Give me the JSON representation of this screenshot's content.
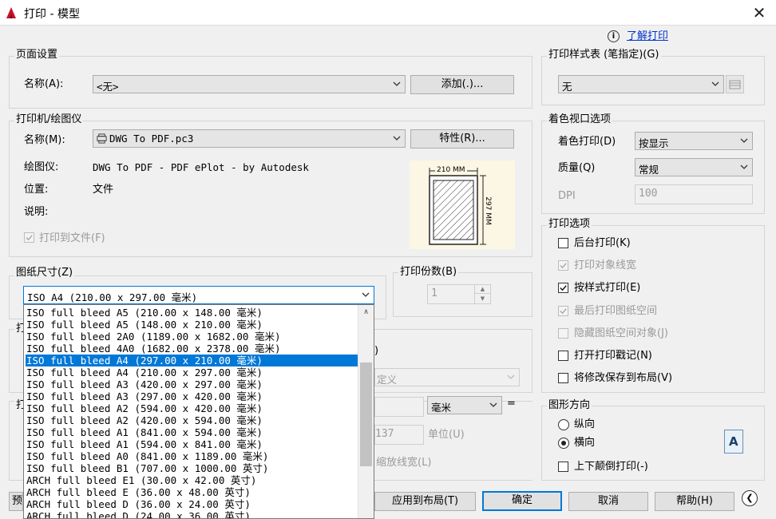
{
  "window": {
    "title": "打印 - 模型"
  },
  "help_link": "了解打印",
  "page_setup": {
    "group_label": "页面设置",
    "name_label": "名称(A):",
    "name_value": "<无>",
    "add_button": "添加(.)..."
  },
  "printer": {
    "group_label": "打印机/绘图仪",
    "name_label": "名称(M):",
    "name_value": "DWG To PDF.pc3",
    "properties_button": "特性(R)...",
    "plotter_label": "绘图仪:",
    "plotter_value": "DWG To PDF - PDF ePlot - by Autodesk",
    "location_label": "位置:",
    "location_value": "文件",
    "description_label": "说明:",
    "print_to_file_label": "打印到文件(F)",
    "preview_width": "210 MM",
    "preview_height": "297 MM"
  },
  "paper_size": {
    "group_label": "图纸尺寸(Z)",
    "selected": "ISO A4 (210.00 x 297.00 毫米)",
    "options": [
      "ISO full bleed A5 (210.00 x 148.00 毫米)",
      "ISO full bleed A5 (148.00 x 210.00 毫米)",
      "ISO full bleed 2A0 (1189.00 x 1682.00 毫米)",
      "ISO full bleed 4A0 (1682.00 x 2378.00 毫米)",
      "ISO full bleed A4 (297.00 x 210.00 毫米)",
      "ISO full bleed A4 (210.00 x 297.00 毫米)",
      "ISO full bleed A3 (420.00 x 297.00 毫米)",
      "ISO full bleed A3 (297.00 x 420.00 毫米)",
      "ISO full bleed A2 (594.00 x 420.00 毫米)",
      "ISO full bleed A2 (420.00 x 594.00 毫米)",
      "ISO full bleed A1 (841.00 x 594.00 毫米)",
      "ISO full bleed A1 (594.00 x 841.00 毫米)",
      "ISO full bleed A0 (841.00 x 1189.00 毫米)",
      "ISO full bleed B1 (707.00 x 1000.00 英寸)",
      "ARCH full bleed E1 (30.00 x 42.00 英寸)",
      "ARCH full bleed E (36.00 x 48.00 英寸)",
      "ARCH full bleed D (36.00 x 24.00 英寸)",
      "ARCH full bleed D (24.00 x 36.00 英寸)"
    ],
    "selected_index": 4
  },
  "copies": {
    "group_label": "打印份数(B)",
    "value": "1"
  },
  "obscured": {
    "combo_value": "定义",
    "unit_value": "毫米",
    "equals": "=",
    "scale_value": "137",
    "unit_label": "单位(U)",
    "scale_lineweights": "缩放线宽(L)"
  },
  "plot_style_table": {
    "group_label": "打印样式表 (笔指定)(G)",
    "value": "无"
  },
  "shaded_viewport": {
    "group_label": "着色视口选项",
    "shade_label": "着色打印(D)",
    "shade_value": "按显示",
    "quality_label": "质量(Q)",
    "quality_value": "常规",
    "dpi_label": "DPI",
    "dpi_value": "100"
  },
  "plot_options": {
    "group_label": "打印选项",
    "items": [
      {
        "label": "后台打印(K)",
        "checked": false,
        "disabled": false
      },
      {
        "label": "打印对象线宽",
        "checked": true,
        "disabled": true
      },
      {
        "label": "按样式打印(E)",
        "checked": true,
        "disabled": false
      },
      {
        "label": "最后打印图纸空间",
        "checked": true,
        "disabled": true
      },
      {
        "label": "隐藏图纸空间对象(J)",
        "checked": false,
        "disabled": true
      },
      {
        "label": "打开打印戳记(N)",
        "checked": false,
        "disabled": false
      },
      {
        "label": "将修改保存到布局(V)",
        "checked": false,
        "disabled": false
      }
    ]
  },
  "orientation": {
    "group_label": "图形方向",
    "portrait": "纵向",
    "landscape": "横向",
    "upside_down": "上下颠倒打印(-)",
    "selected": "landscape",
    "preview_letter": "A"
  },
  "footer": {
    "apply_to_layout": "应用到布局(T)",
    "ok": "确定",
    "cancel": "取消",
    "help": "帮助(H)"
  },
  "colors": {
    "accent": "#0078d7",
    "help_link": "#0033cc"
  }
}
